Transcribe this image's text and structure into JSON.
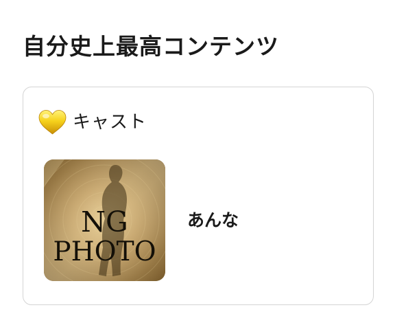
{
  "section": {
    "title": "自分史上最高コンテンツ"
  },
  "card": {
    "icon": "gold-heart-icon",
    "header_label": "キャスト",
    "cast": [
      {
        "name": "あんな",
        "photo": {
          "placeholder_line1": "NG",
          "placeholder_line2": "PHOTO"
        }
      }
    ]
  },
  "colors": {
    "heart_gold": "#f2c81a",
    "photo_gold": "#b8944f",
    "card_border": "#d4d4d4"
  }
}
